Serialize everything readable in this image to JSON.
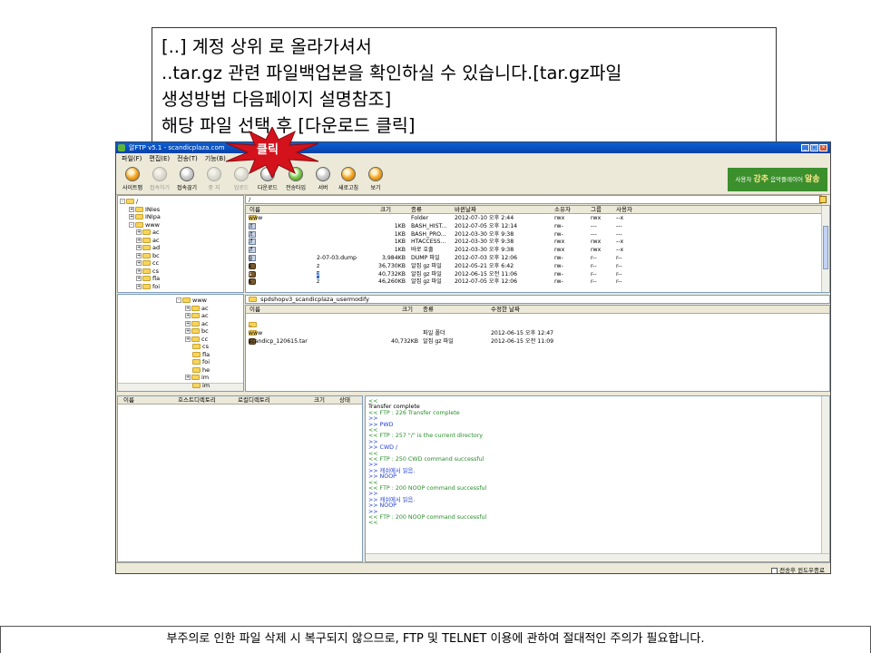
{
  "callout": {
    "lines": [
      "[..] 계정 상위 로 올라가셔서",
      "..tar.gz 관련 파일백업본을 확인하실 수 있습니다.[tar.gz파일",
      "생성방법 다음페이지 설명참조]",
      "해당 파일 선택 후 [다운로드 클릭]"
    ]
  },
  "annotation": {
    "label": "클릭",
    "color": "#d4121b"
  },
  "footer": {
    "note": "부주의로 인한 파일 삭제 시 복구되지 않으므로, FTP 및 TELNET 이용에 관하여 절대적인 주의가 필요합니다."
  },
  "window": {
    "title": "알FTP v5.1 - scandicplaza.com",
    "menu": [
      "파일(F)",
      "편집(E)",
      "전송(T)",
      "기능(B)"
    ],
    "toolbar": [
      {
        "label": "사이트맵",
        "icon": "sitemap-icon",
        "style": "orange"
      },
      {
        "label": "접속하기",
        "icon": "connect-icon",
        "style": "dim"
      },
      {
        "label": "접속끊기",
        "icon": "disconnect-icon",
        "style": "normal"
      },
      {
        "label": "중 지",
        "icon": "stop-icon",
        "style": "dim"
      },
      {
        "label": "업로드",
        "icon": "upload-icon",
        "style": "dim"
      },
      {
        "label": "다운로드",
        "icon": "download-icon",
        "style": "normal"
      },
      {
        "label": "전송타입",
        "icon": "transfer-type-icon",
        "style": "green"
      },
      {
        "label": "서버",
        "icon": "server-icon",
        "style": "normal"
      },
      {
        "label": "새로고침",
        "icon": "refresh-icon",
        "style": "orange"
      },
      {
        "label": "보기",
        "icon": "view-icon",
        "style": "orange"
      }
    ],
    "ad": {
      "prefix": "사용자",
      "name": "강추",
      "text": "음악플레이어",
      "brand": "알송"
    },
    "remote": {
      "path": "/",
      "tree": [
        {
          "label": "/",
          "pm": "-"
        },
        {
          "label": "INIes",
          "pm": "+"
        },
        {
          "label": "INIpa",
          "pm": "+"
        },
        {
          "label": "www",
          "pm": "-"
        },
        {
          "label": "ac",
          "pm": "+"
        },
        {
          "label": "ac",
          "pm": "+"
        },
        {
          "label": "ad",
          "pm": "+"
        },
        {
          "label": "bc",
          "pm": "+"
        },
        {
          "label": "cc",
          "pm": "+"
        },
        {
          "label": "cs",
          "pm": "+"
        },
        {
          "label": "fla",
          "pm": "+"
        },
        {
          "label": "foi",
          "pm": "+"
        }
      ],
      "columns": [
        "이름",
        "크기",
        "종류",
        "바뀐날짜",
        "소유자",
        "그룹",
        "사용자"
      ],
      "rows": [
        {
          "name": "www",
          "extra": "",
          "size": "",
          "type": "Folder",
          "date": "2012-07-10 오후 2:44",
          "owner": "rwx",
          "group": "rwx",
          "user": "--x",
          "icon": "folder",
          "sel": false
        },
        {
          "name": ".t",
          "extra": "",
          "size": "1KB",
          "type": "BASH_HIST...",
          "date": "2012-07-05 오후 12:14",
          "owner": "rw-",
          "group": "---",
          "user": "---",
          "icon": "file",
          "sel": false
        },
        {
          "name": ".t",
          "extra": "",
          "size": "1KB",
          "type": "BASH_PRO...",
          "date": "2012-03-30 오후 9:38",
          "owner": "rw-",
          "group": "---",
          "user": "---",
          "icon": "file",
          "sel": false
        },
        {
          "name": ".f",
          "extra": "",
          "size": "1KB",
          "type": "HTACCESS...",
          "date": "2012-03-30 오후 9:38",
          "owner": "rwx",
          "group": "rwx",
          "user": "--x",
          "icon": "file",
          "sel": false
        },
        {
          "name": ".f",
          "extra": "",
          "size": "1KB",
          "type": "바로 호출",
          "date": "2012-03-30 오후 9:38",
          "owner": "rwx",
          "group": "rwx",
          "user": "--x",
          "icon": "file",
          "sel": false
        },
        {
          "name": "g",
          "extra": "2-07-03.dump",
          "size": "3,984KB",
          "type": "DUMP 파일",
          "date": "2012-07-03 오후 12:06",
          "owner": "rw-",
          "group": "r--",
          "user": "r--",
          "icon": "file",
          "sel": false
        },
        {
          "name": "s",
          "extra": "z",
          "size": "36,730KB",
          "type": "알집 gz 파일",
          "date": "2012-05-21 오후 6:42",
          "owner": "rw-",
          "group": "r--",
          "user": "r--",
          "icon": "zip",
          "sel": false
        },
        {
          "name": "s",
          "extra": "z",
          "size": "40,732KB",
          "type": "알집 gz 파일",
          "date": "2012-06-15 오전 11:06",
          "owner": "rw-",
          "group": "r--",
          "user": "r--",
          "icon": "zip",
          "sel": true
        },
        {
          "name": "s",
          "extra": "z",
          "size": "46,260KB",
          "type": "알집 gz 파일",
          "date": "2012-07-05 오후 12:06",
          "owner": "rw-",
          "group": "r--",
          "user": "r--",
          "icon": "zip",
          "sel": false
        }
      ]
    },
    "local": {
      "path": "spdshopv3_scandicplaza_usermodify",
      "tree": [
        {
          "label": "www",
          "pm": "-"
        },
        {
          "label": "ac",
          "pm": "+"
        },
        {
          "label": "ac",
          "pm": "+"
        },
        {
          "label": "ac",
          "pm": "+"
        },
        {
          "label": "bc",
          "pm": "+"
        },
        {
          "label": "cc",
          "pm": "+"
        },
        {
          "label": "cs",
          "pm": ""
        },
        {
          "label": "fla",
          "pm": ""
        },
        {
          "label": "foi",
          "pm": ""
        },
        {
          "label": "he",
          "pm": ""
        },
        {
          "label": "im",
          "pm": "+"
        },
        {
          "label": "im",
          "pm": ""
        }
      ],
      "columns": [
        "이름",
        "크기",
        "종류",
        "수정한 날짜"
      ],
      "rows": [
        {
          "name": "..",
          "size": "",
          "type": "",
          "date": "",
          "icon": "folder"
        },
        {
          "name": "www",
          "size": "",
          "type": "파일 폴더",
          "date": "2012-06-15 오후 12:47",
          "icon": "folder"
        },
        {
          "name": "scandicp_120615.tar",
          "size": "40,732KB",
          "type": "알집 gz 파일",
          "date": "2012-06-15 오전 11:09",
          "icon": "zip"
        }
      ]
    },
    "queue": {
      "columns": [
        "이름",
        "호스트디렉토리",
        "로컬디렉토리",
        "크기",
        "상태"
      ]
    },
    "log": [
      {
        "text": "<<",
        "color": "#2a8c2a"
      },
      {
        "text": "Transfer complete",
        "color": "#000000"
      },
      {
        "text": "<< FTP : 226 Transfer complete",
        "color": "#2a8c2a"
      },
      {
        "text": ">>",
        "color": "#1f3fd1"
      },
      {
        "text": ">> PWD",
        "color": "#1f3fd1"
      },
      {
        "text": "<<",
        "color": "#2a8c2a"
      },
      {
        "text": "<< FTP : 257 \"/\" is the current directory",
        "color": "#2a8c2a"
      },
      {
        "text": ">>",
        "color": "#1f3fd1"
      },
      {
        "text": ">> CWD /",
        "color": "#1f3fd1"
      },
      {
        "text": "<<",
        "color": "#2a8c2a"
      },
      {
        "text": "<< FTP : 250 CWD command successful",
        "color": "#2a8c2a"
      },
      {
        "text": ">>",
        "color": "#1f3fd1"
      },
      {
        "text": ">> 캐쉬에서 읽음.",
        "color": "#1f3fd1"
      },
      {
        "text": ">> NOOP",
        "color": "#1f3fd1"
      },
      {
        "text": "<<",
        "color": "#2a8c2a"
      },
      {
        "text": "<< FTP : 200 NOOP command successful",
        "color": "#2a8c2a"
      },
      {
        "text": ">>",
        "color": "#1f3fd1"
      },
      {
        "text": ">> 캐쉬에서 읽음.",
        "color": "#1f3fd1"
      },
      {
        "text": ">> NOOP",
        "color": "#1f3fd1"
      },
      {
        "text": ">>",
        "color": "#1f3fd1"
      },
      {
        "text": "<< FTP : 200 NOOP command successful",
        "color": "#2a8c2a"
      },
      {
        "text": "<<",
        "color": "#2a8c2a"
      }
    ],
    "status": {
      "checkbox_label": "전송후 윈도우종료"
    }
  }
}
